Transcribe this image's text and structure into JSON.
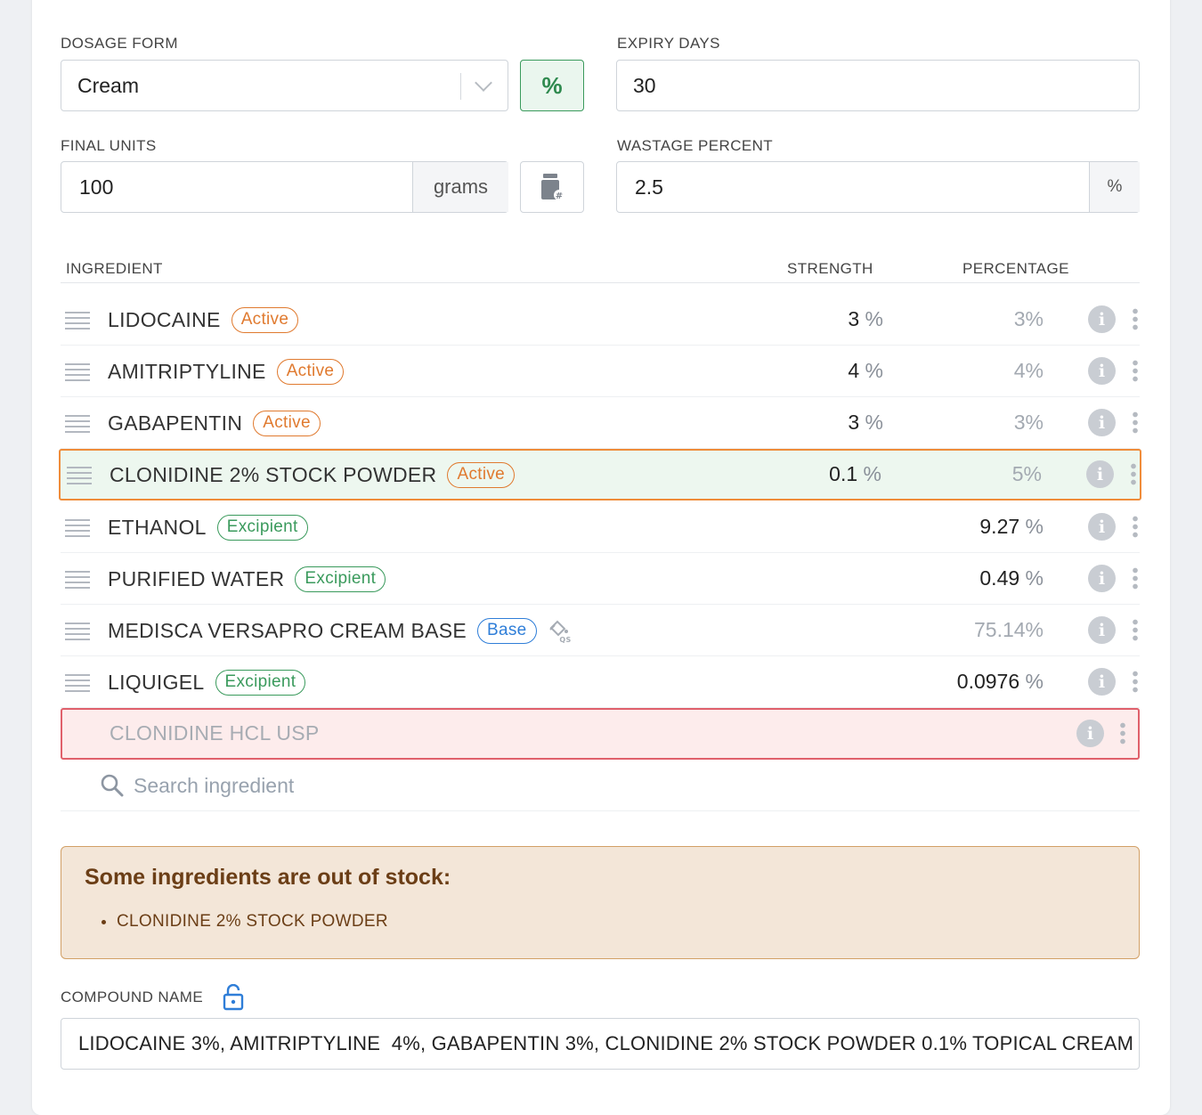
{
  "form": {
    "dosage_form_label": "DOSAGE FORM",
    "dosage_form_value": "Cream",
    "percent_toggle": "%",
    "expiry_label": "EXPIRY DAYS",
    "expiry_value": "30",
    "final_units_label": "FINAL UNITS",
    "final_units_value": "100",
    "final_units_unit": "grams",
    "wastage_label": "WASTAGE PERCENT",
    "wastage_value": "2.5",
    "wastage_unit": "%"
  },
  "table": {
    "headers": {
      "ingredient": "INGREDIENT",
      "strength": "STRENGTH",
      "percentage": "PERCENTAGE"
    },
    "rows": [
      {
        "name": "LIDOCAINE",
        "badge": "Active",
        "strength": "3",
        "strength_unit": "%",
        "percentage": "3%"
      },
      {
        "name": "AMITRIPTYLINE",
        "badge": "Active",
        "strength": "4",
        "strength_unit": "%",
        "percentage": "4%"
      },
      {
        "name": "GABAPENTIN",
        "badge": "Active",
        "strength": "3",
        "strength_unit": "%",
        "percentage": "3%"
      },
      {
        "name": "CLONIDINE 2% STOCK POWDER",
        "badge": "Active",
        "strength": "0.1",
        "strength_unit": "%",
        "percentage": "5%"
      },
      {
        "name": "ETHANOL",
        "badge": "Excipient",
        "percentage": "9.27",
        "percentage_unit": "%"
      },
      {
        "name": "PURIFIED WATER",
        "badge": "Excipient",
        "percentage": "0.49",
        "percentage_unit": "%"
      },
      {
        "name": "MEDISCA VERSAPRO CREAM BASE",
        "badge": "Base",
        "percentage": "75.14%"
      },
      {
        "name": "LIQUIGEL",
        "badge": "Excipient",
        "percentage": "0.0976",
        "percentage_unit": "%"
      },
      {
        "name": "CLONIDINE HCL USP"
      }
    ],
    "search_placeholder": "Search ingredient"
  },
  "alert": {
    "title": "Some ingredients are out of stock:",
    "items": [
      "CLONIDINE 2% STOCK POWDER"
    ]
  },
  "compound": {
    "label": "COMPOUND NAME",
    "value": "LIDOCAINE 3%, AMITRIPTYLINE  4%, GABAPENTIN 3%, CLONIDINE 2% STOCK POWDER 0.1% TOPICAL CREAM"
  },
  "colors": {
    "active_badge": "#e07a2f",
    "excipient_badge": "#3a9a5c",
    "base_badge": "#2f7ed8",
    "highlight_border": "#ef8c3a",
    "error_border": "#e0606b",
    "alert_text": "#6b3e16"
  },
  "icons": {
    "qs_icon": "bucket-qs-icon",
    "lock_icon": "unlocked-padlock-icon",
    "units_button_icon": "container-hash-icon"
  }
}
